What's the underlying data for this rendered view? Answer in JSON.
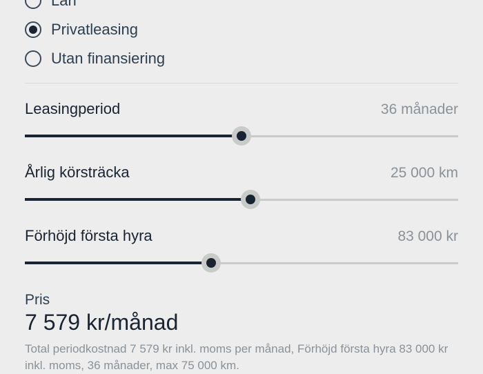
{
  "financing_options": [
    {
      "label": "Lån",
      "selected": false
    },
    {
      "label": "Privatleasing",
      "selected": true
    },
    {
      "label": "Utan finansiering",
      "selected": false
    }
  ],
  "sliders": {
    "period": {
      "label": "Leasingperiod",
      "value": "36 månader",
      "position": 50
    },
    "mileage": {
      "label": "Årlig körsträcka",
      "value": "25 000 km",
      "position": 52
    },
    "down_payment": {
      "label": "Förhöjd första hyra",
      "value": "83 000 kr",
      "position": 43
    }
  },
  "price": {
    "label": "Pris",
    "amount": "7 579 kr/månad",
    "summary": "Total periodkostnad 7 579 kr inkl. moms per månad, Förhöjd första hyra 83 000 kr inkl. moms, 36 månader, max 75 000 km."
  }
}
